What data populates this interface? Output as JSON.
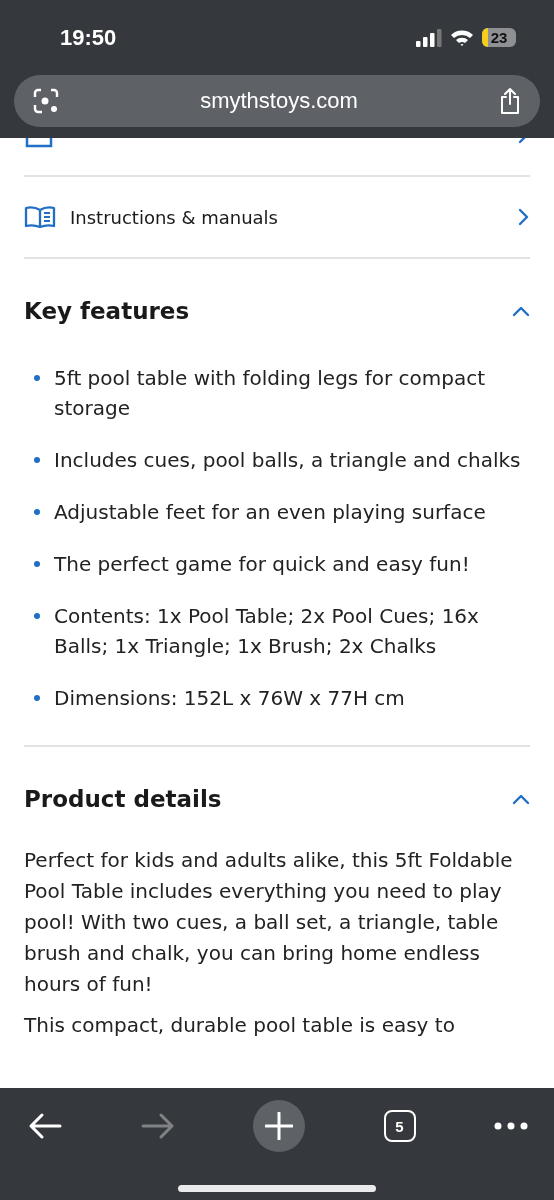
{
  "browser": {
    "time": "19:50",
    "battery": "23",
    "url": "smythstoys.com",
    "tab_count": "5"
  },
  "links": [
    {
      "kind": "delivery"
    },
    {
      "label": "Instructions & manuals",
      "kind": "manual"
    }
  ],
  "sections": [
    {
      "title": "Key features",
      "expanded": true,
      "bullets": [
        "5ft pool table with folding legs for compact storage",
        "Includes cues, pool balls, a triangle and chalks",
        "Adjustable feet for an even playing surface",
        "The perfect game for quick and easy fun!",
        "Contents: 1x Pool Table; 2x Pool Cues; 16x Balls; 1x Triangle; 1x Brush; 2x Chalks",
        "Dimensions: 152L x 76W x 77H cm"
      ]
    },
    {
      "title": "Product details",
      "expanded": true,
      "paragraphs": [
        "Perfect for kids and adults alike, this 5ft Foldable Pool Table includes everything you need to play pool! With two cues, a ball set, a triangle, table brush and chalk, you can bring home endless hours of fun!",
        "This compact, durable pool table is easy to"
      ]
    }
  ]
}
